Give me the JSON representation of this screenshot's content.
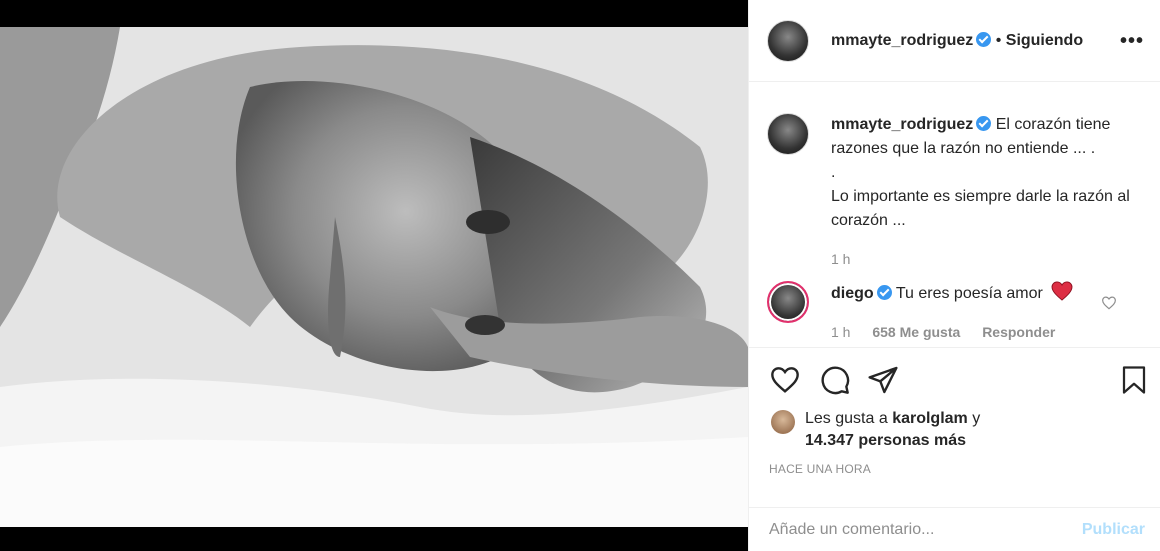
{
  "post": {
    "author": "mmayte_rodriguez",
    "follow_status": "Siguiendo",
    "more_label": "•••",
    "caption_line1": "El corazón tiene razones que la razón no entiende ... .",
    "caption_dot": ".",
    "caption_line2": "Lo importante es siempre darle la razón al corazón ...",
    "caption_time": "1 h"
  },
  "comment": {
    "author": "diego",
    "text": "Tu eres poesía amor",
    "time": "1 h",
    "likes": "658 Me gusta",
    "reply": "Responder"
  },
  "likes": {
    "prefix": "Les gusta a",
    "user": "karolglam",
    "conj": "y",
    "count": "14.347 personas más",
    "ago": "HACE UNA HORA"
  },
  "composer": {
    "placeholder": "Añade un comentario...",
    "publish": "Publicar"
  },
  "colors": {
    "verified": "#3897f0",
    "heart": "#ed4956",
    "publish_disabled": "#b2dffc"
  },
  "icons": [
    "verified-badge-icon",
    "more-icon",
    "heart-icon",
    "comment-icon",
    "share-icon",
    "bookmark-icon",
    "red-heart-emoji"
  ]
}
